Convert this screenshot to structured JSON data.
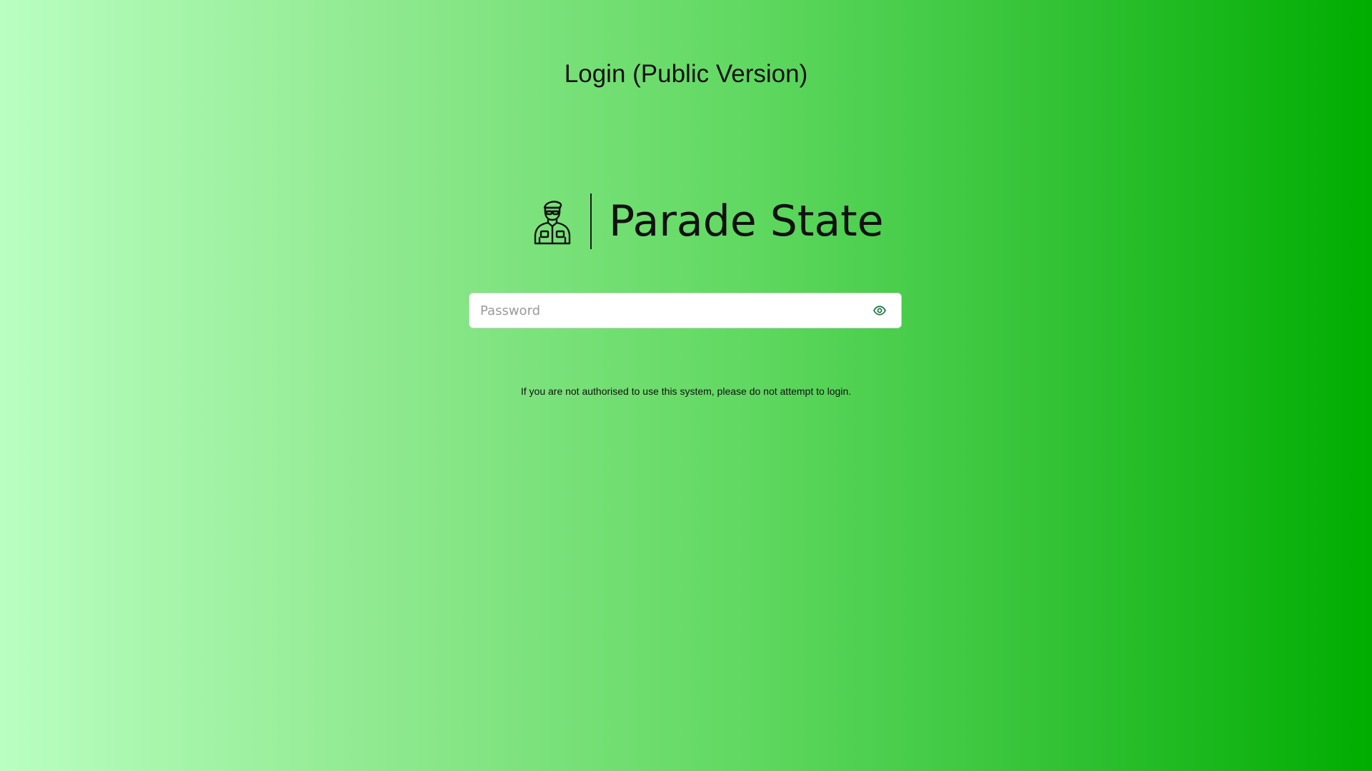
{
  "page": {
    "title": "Login (Public Version)",
    "background_start": "#b9ffc1",
    "background_end": "#00ad00"
  },
  "logo": {
    "icon": "soldier-icon",
    "text": "Parade State"
  },
  "password": {
    "placeholder": "Password",
    "value": "",
    "toggle_icon": "eye-icon",
    "toggle_color": "#1f7a4d"
  },
  "notice": {
    "text": "If you are not authorised to use this system, please do not attempt to login."
  }
}
